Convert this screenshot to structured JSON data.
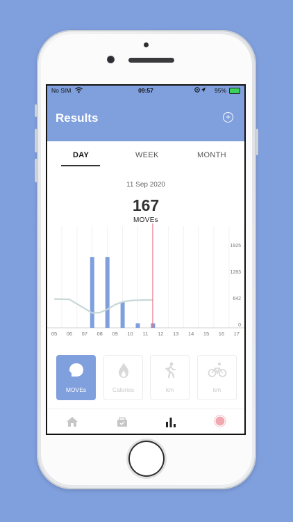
{
  "status": {
    "carrier": "No SIM",
    "time": "09:57",
    "battery": "95%"
  },
  "header": {
    "title": "Results"
  },
  "tabs": [
    {
      "label": "DAY",
      "active": true
    },
    {
      "label": "WEEK",
      "active": false
    },
    {
      "label": "MONTH",
      "active": false
    }
  ],
  "summary": {
    "date": "11 Sep 2020",
    "value": "167",
    "unit": "MOVEs"
  },
  "chart_data": {
    "type": "bar",
    "categories": [
      "05",
      "06",
      "07",
      "08",
      "09",
      "10",
      "11",
      "12",
      "13",
      "14",
      "15",
      "16",
      "17"
    ],
    "values": [
      0,
      0,
      1720,
      1720,
      620,
      110,
      110,
      0,
      0,
      0,
      0,
      0,
      0
    ],
    "y_ticks": [
      "0",
      "642",
      "1283",
      "1925"
    ],
    "y_tick_values": [
      0,
      642,
      1283,
      1925
    ],
    "ylim": [
      0,
      1925
    ],
    "trend": {
      "x": [
        4.5,
        5.5,
        6.5,
        7.0,
        7.5,
        8.0,
        8.5,
        9.0,
        9.5,
        10.0,
        10.5,
        11.0
      ],
      "y": [
        700,
        690,
        470,
        360,
        370,
        450,
        560,
        630,
        660,
        670,
        675,
        675
      ]
    },
    "highlight_category": "11",
    "colors": {
      "bar": "#7f9fdd",
      "trend": "#c7d7d6",
      "highlight": "#e86b7e",
      "grid": "#eeeeee"
    }
  },
  "metrics": [
    {
      "label": "MOVEs",
      "icon": "chat-bubble-icon",
      "active": true
    },
    {
      "label": "Calories",
      "icon": "flame-icon",
      "active": false
    },
    {
      "label": "km",
      "icon": "walker-icon",
      "active": false
    },
    {
      "label": "km",
      "icon": "bicycle-icon",
      "active": false
    }
  ],
  "nav": [
    {
      "icon": "home-icon"
    },
    {
      "icon": "basket-icon"
    },
    {
      "icon": "bar-chart-icon",
      "active": true
    },
    {
      "icon": "record-icon"
    }
  ],
  "colors": {
    "accent": "#7f9fdd",
    "record": "#f1a8b0"
  }
}
